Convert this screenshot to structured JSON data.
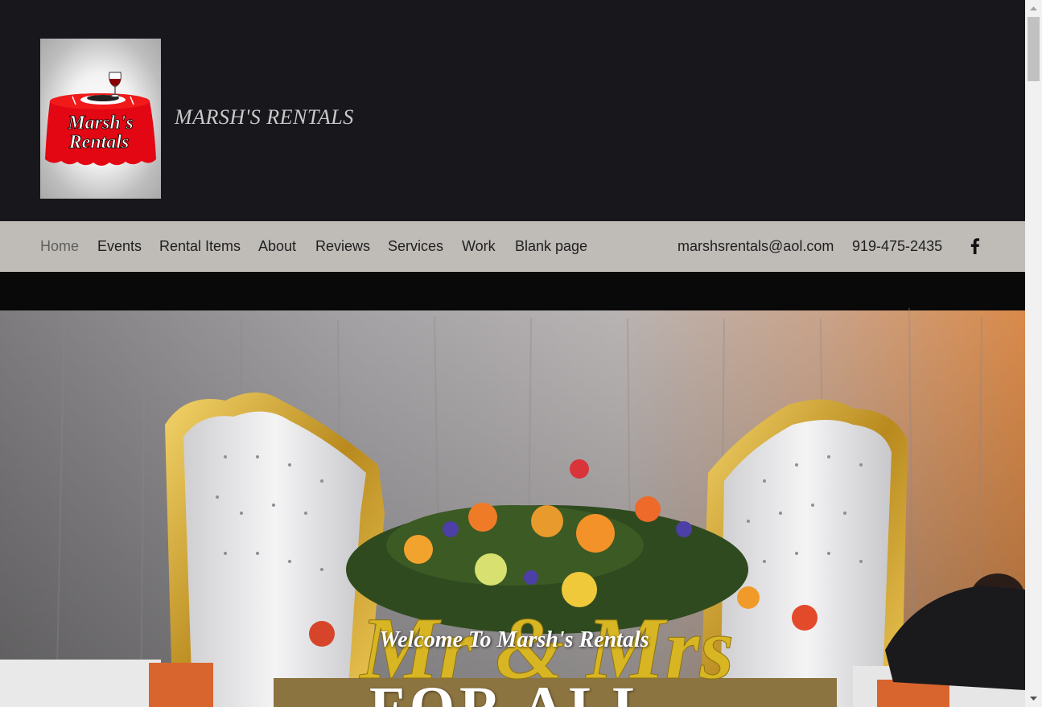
{
  "header": {
    "site_title": "MARSH'S RENTALS",
    "logo": {
      "alt": "Marsh's Rentals logo",
      "text_line1": "Marsh's",
      "text_line2": "Rentals"
    }
  },
  "nav": {
    "items": [
      {
        "label": "Home",
        "active": true
      },
      {
        "label": "Events",
        "active": false
      },
      {
        "label": "Rental Items",
        "active": false
      },
      {
        "label": "About",
        "active": false
      },
      {
        "label": "Reviews",
        "active": false
      },
      {
        "label": "Services",
        "active": false
      },
      {
        "label": "Work",
        "active": false
      },
      {
        "label": "Blank page",
        "active": false
      }
    ],
    "email": "marshsrentals@aol.com",
    "phone": "919-475-2435",
    "social_icon": "facebook-icon"
  },
  "hero": {
    "welcome": "Welcome To Marsh's Rentals",
    "headline": "FOR ALL",
    "sign_text": "Mr & Mrs"
  },
  "colors": {
    "header_bg": "#18171c",
    "nav_bg": "#bfbcb8",
    "title_color": "#c9c9c9",
    "logo_red": "#e30613"
  }
}
